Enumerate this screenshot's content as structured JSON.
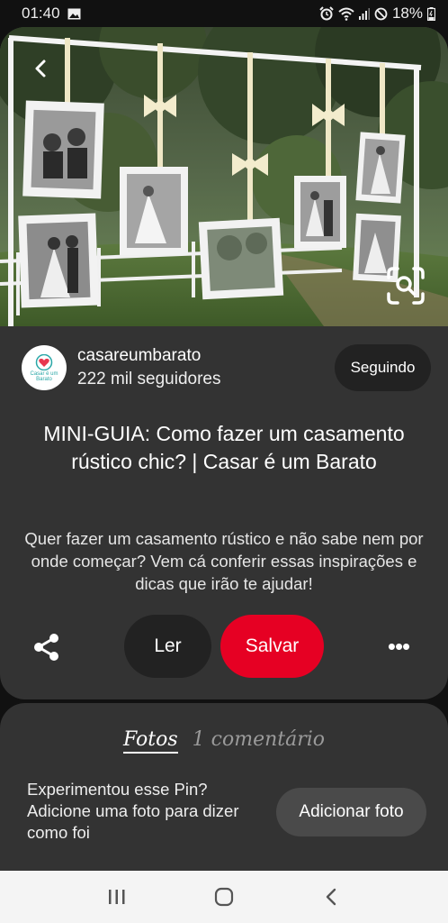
{
  "status_bar": {
    "time": "01:40",
    "battery": "18%",
    "icons": [
      "gallery-icon",
      "alarm-icon",
      "wifi-icon",
      "signal-icon",
      "mute-icon",
      "battery-icon"
    ]
  },
  "pin": {
    "image_description_icon": "photo-icon",
    "author": {
      "name": "casareumbarato",
      "followers": "222 mil seguidores",
      "avatar_text": "Casar é um Barato"
    },
    "follow_label": "Seguindo",
    "title": "MINI-GUIA: Como fazer um casamento rústico chic? | Casar é um Barato",
    "description": "Quer fazer um casamento rústico e não sabe nem por onde começar? Vem cá conferir essas inspirações e dicas que irão te ajudar!",
    "actions": {
      "read_label": "Ler",
      "save_label": "Salvar",
      "more_label": "•••"
    }
  },
  "comments_section": {
    "tab_photos": "Fotos",
    "tab_comments": "1 comentário",
    "tried_prompt": "Experimentou esse Pin? Adicione uma foto para dizer como foi",
    "add_photo_label": "Adicionar foto"
  },
  "colors": {
    "accent": "#e60023",
    "card": "#333333",
    "background": "#111111"
  }
}
